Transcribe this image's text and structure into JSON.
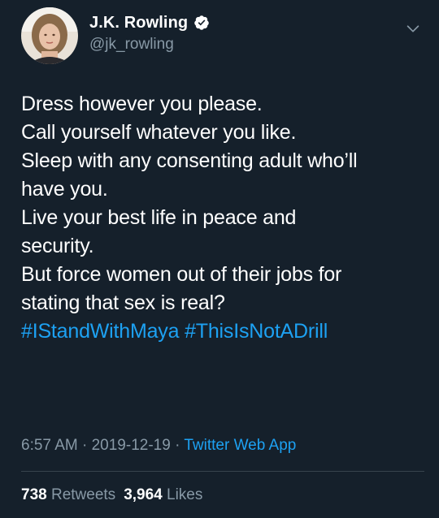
{
  "author": {
    "display_name": "J.K. Rowling",
    "handle": "@jk_rowling",
    "verified": true
  },
  "tweet": {
    "lines": [
      "Dress however you please.",
      "Call yourself whatever you like.",
      "Sleep with any consenting adult who’ll",
      "have you.",
      "Live your best life in peace and",
      "security.",
      "But force women out of their jobs for",
      "stating that sex is real?"
    ],
    "hashtags": [
      "#IStandWithMaya",
      "#ThisIsNotADrill"
    ]
  },
  "meta": {
    "time": "6:57 AM",
    "separator": "·",
    "date": "2019-12-19",
    "source": "Twitter Web App"
  },
  "stats": {
    "retweets_count": "738",
    "retweets_label": "Retweets",
    "likes_count": "3,964",
    "likes_label": "Likes"
  },
  "colors": {
    "background": "#15202b",
    "text": "#ffffff",
    "secondary": "#8899a6",
    "accent": "#1da1f2"
  },
  "icons": {
    "verified": "verified-badge-icon",
    "menu": "chevron-down-icon"
  }
}
